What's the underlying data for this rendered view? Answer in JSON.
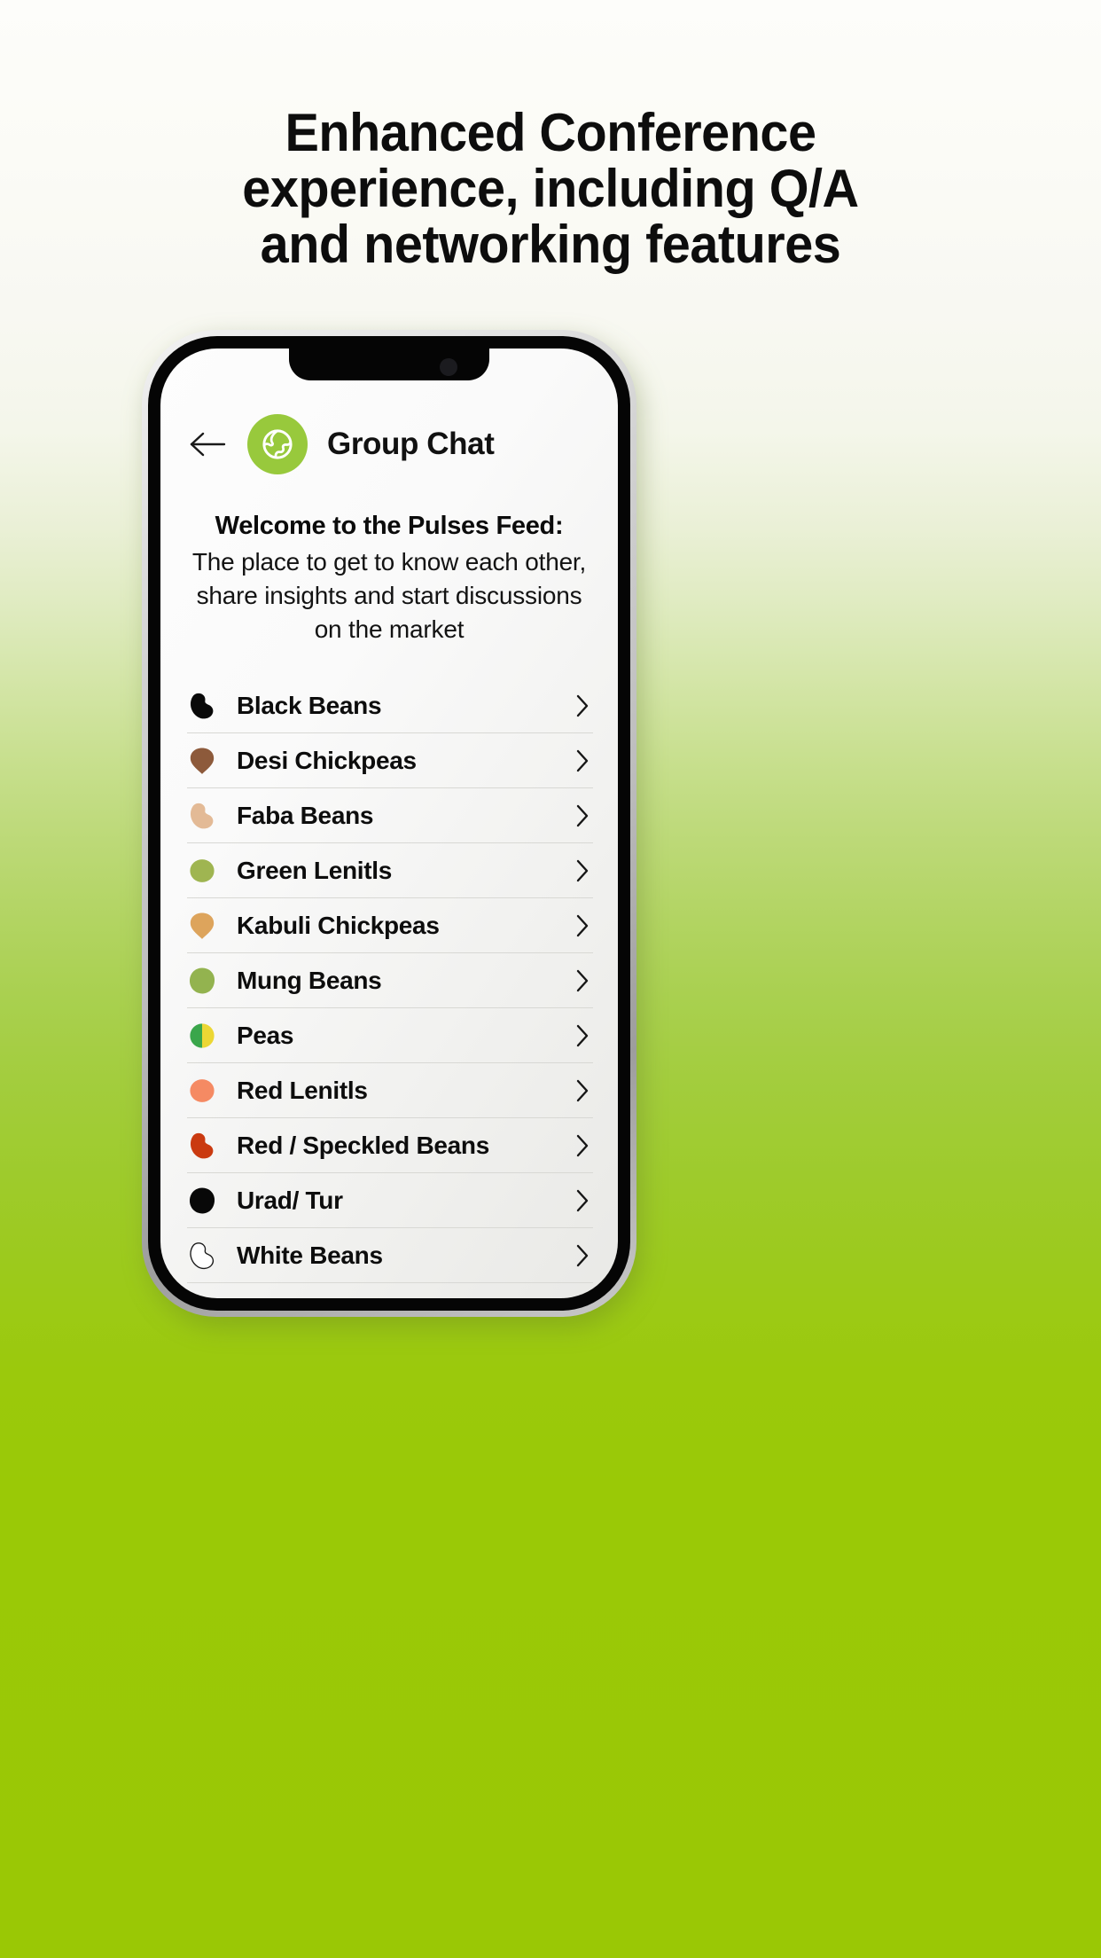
{
  "promo": {
    "headline_lines": [
      "Enhanced Conference",
      "experience, including Q/A",
      "and networking features"
    ]
  },
  "theme": {
    "brand_green": "#98c93c",
    "background_green": "#9ac805",
    "background_top": "#fdfdfa",
    "screen_bg": "#fafafa",
    "divider": "#d8d8d4",
    "text_dark": "#0d0d0d"
  },
  "phone": {
    "status_notch": "notch"
  },
  "chat": {
    "back_label": "back-arrow",
    "logo_label": "globe-logo",
    "title": "Group Chat"
  },
  "welcome": {
    "title": "Welcome to the Pulses Feed:",
    "body": "The place to get to know each other, share insights and start discussions on the market"
  },
  "list": {
    "items": [
      {
        "label": "Black Beans",
        "icon": "bean-icon-black",
        "shape": "kidney",
        "color": "#090909",
        "outline": false
      },
      {
        "label": "Desi Chickpeas",
        "icon": "bean-icon-desi-chickpea",
        "shape": "teardrop",
        "color": "#8d5a3b",
        "outline": false
      },
      {
        "label": "Faba Beans",
        "icon": "bean-icon-faba",
        "shape": "kidney",
        "color": "#e3ba96",
        "outline": false
      },
      {
        "label": "Green Lenitls",
        "icon": "bean-icon-green-lentil",
        "shape": "round",
        "color": "#9fb551",
        "outline": false
      },
      {
        "label": "Kabuli Chickpeas",
        "icon": "bean-icon-kabuli-chickpea",
        "shape": "teardrop",
        "color": "#dda45c",
        "outline": false
      },
      {
        "label": "Mung Beans",
        "icon": "bean-icon-mung",
        "shape": "blob",
        "color": "#93b34f",
        "outline": false
      },
      {
        "label": "Peas",
        "icon": "bean-icon-pea",
        "shape": "split",
        "color": "#3aa64b",
        "color2": "#ecd734",
        "outline": false
      },
      {
        "label": "Red Lenitls",
        "icon": "bean-icon-red-lentil",
        "shape": "round",
        "color": "#f58a63",
        "outline": false
      },
      {
        "label": "Red / Speckled Beans",
        "icon": "bean-icon-red-speckled",
        "shape": "kidney",
        "color": "#ca3a10",
        "outline": false
      },
      {
        "label": "Urad/ Tur",
        "icon": "bean-icon-urad-tur",
        "shape": "blob",
        "color": "#080808",
        "outline": false
      },
      {
        "label": "White Beans",
        "icon": "bean-icon-white",
        "shape": "kidney",
        "color": "#ffffff",
        "outline": true
      }
    ],
    "chevron": "chevron-right-icon"
  }
}
